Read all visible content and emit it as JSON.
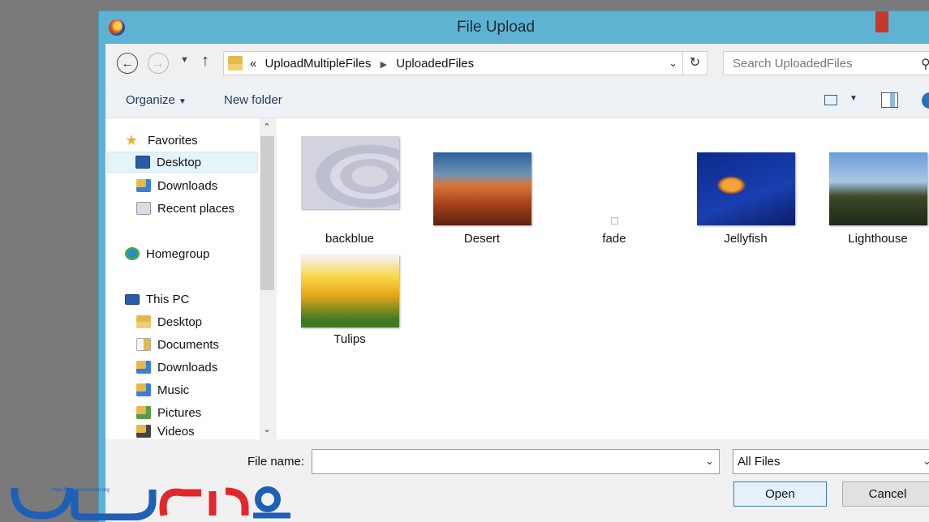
{
  "window": {
    "title": "File Upload"
  },
  "address": {
    "overflow": "«",
    "path": [
      "UploadMultipleFiles",
      "UploadedFiles"
    ],
    "search_placeholder": "Search UploadedFiles"
  },
  "toolbar": {
    "organize": "Organize",
    "new_folder": "New folder"
  },
  "nav": {
    "favorites": "Favorites",
    "desktop": "Desktop",
    "downloads": "Downloads",
    "recent": "Recent places",
    "homegroup": "Homegroup",
    "this_pc": "This PC",
    "pc_desktop": "Desktop",
    "documents": "Documents",
    "pc_downloads": "Downloads",
    "music": "Music",
    "pictures": "Pictures",
    "videos": "Videos"
  },
  "files": [
    "backblue",
    "Desert",
    "fade",
    "Jellyfish",
    "Lighthouse",
    "Tulips"
  ],
  "bottom": {
    "file_name_label": "File name:",
    "file_name_value": "",
    "file_type": "All Files",
    "open": "Open",
    "cancel": "Cancel"
  },
  "watermark": {
    "url": "www.BarnameNevisan.org"
  },
  "colors": {
    "titlebar": "#5fb3d2",
    "accent": "#3c7fb1",
    "logo_blue": "#1e5fb8",
    "logo_red": "#e0282c"
  }
}
